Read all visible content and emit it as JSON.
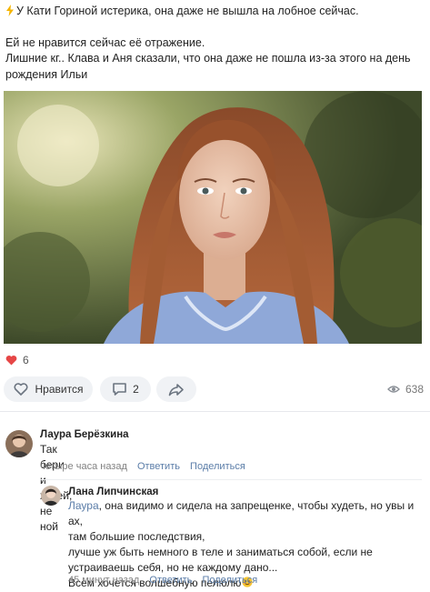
{
  "post": {
    "line1": "У Кати Гориной истерика, она даже не вышла на лобное сейчас.",
    "line2": "Ей не нравится сейчас её отражение.",
    "line3": "Лишние кг.. Клава и Аня сказали, что она даже не пошла из-за этого на день",
    "line4": "рождения Ильи"
  },
  "reactions": {
    "count": "6"
  },
  "actions": {
    "like_label": "Нравится",
    "comment_count": "2",
    "views": "638"
  },
  "comments": [
    {
      "author": "Лаура Берёзкина",
      "text": "Так бери и худей, не ной",
      "time": "четыре часа назад",
      "reply_label": "Ответить",
      "share_label": "Поделиться"
    },
    {
      "author": "Лана Липчинская",
      "mention": "Лаура",
      "line1_rest": ", она видимо и сидела на запрещенке, чтобы худеть, но увы и ах,",
      "line2": "там большие последствия,",
      "line3": "лучше уж быть немного в теле и заниматься собой, если не",
      "line4": "устраиваешь себя, но не каждому дано...",
      "line5": "Всем хочется волшебную пелюлю",
      "time": "45 минут назад",
      "reply_label": "Ответить",
      "share_label": "Поделиться"
    }
  ],
  "colors": {
    "accent": "#5b7da8",
    "like_heart": "#e64646",
    "button_bg": "#f0f2f5"
  }
}
